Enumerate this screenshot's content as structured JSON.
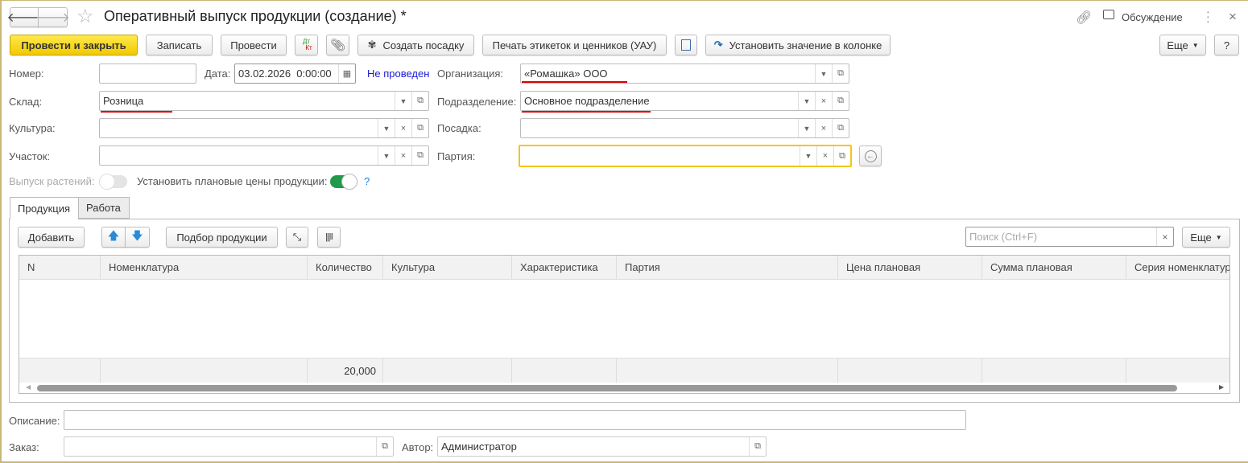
{
  "window": {
    "title": "Оперативный выпуск продукции (создание) *",
    "discussion": "Обсуждение",
    "close": "×"
  },
  "toolbar": {
    "post_close": "Провести и закрыть",
    "save": "Записать",
    "post": "Провести",
    "dt": "Дт",
    "kt": "Кт",
    "create_planting": "Создать посадку",
    "print_labels": "Печать этикеток и ценников (УАУ)",
    "set_column_value": "Установить значение в колонке",
    "more": "Еще",
    "help": "?"
  },
  "form": {
    "number_label": "Номер:",
    "number_value": "",
    "date_label": "Дата:",
    "date_value": "03.02.2026  0:00:00",
    "status": "Не проведен",
    "org_label": "Организация:",
    "org_value": "«Ромашка» ООО",
    "warehouse_label": "Склад:",
    "warehouse_value": "Розница",
    "division_label": "Подразделение:",
    "division_value": "Основное подразделение",
    "culture_label": "Культура:",
    "culture_value": "",
    "planting_label": "Посадка:",
    "planting_value": "",
    "plot_label": "Участок:",
    "plot_value": "",
    "batch_label": "Партия:",
    "batch_value": "",
    "plants_output_label": "Выпуск растений:",
    "plants_output_on": false,
    "plan_prices_label": "Установить плановые цены продукции:",
    "plan_prices_on": true,
    "plan_prices_help": "?"
  },
  "tabs": [
    {
      "label": "Продукция",
      "active": true
    },
    {
      "label": "Работа",
      "active": false
    }
  ],
  "table_toolbar": {
    "add": "Добавить",
    "pick": "Подбор продукции",
    "search_placeholder": "Поиск (Ctrl+F)",
    "clear": "×",
    "more": "Еще"
  },
  "table": {
    "columns": [
      "N",
      "Номенклатура",
      "Количество",
      "Культура",
      "Характеристика",
      "Партия",
      "Цена плановая",
      "Сумма плановая",
      "Серия номенклатуры"
    ],
    "rows": [],
    "totals": {
      "quantity": "20,000"
    }
  },
  "footer": {
    "description_label": "Описание:",
    "description_value": "",
    "order_label": "Заказ:",
    "order_value": "",
    "author_label": "Автор:",
    "author_value": "Администратор"
  }
}
